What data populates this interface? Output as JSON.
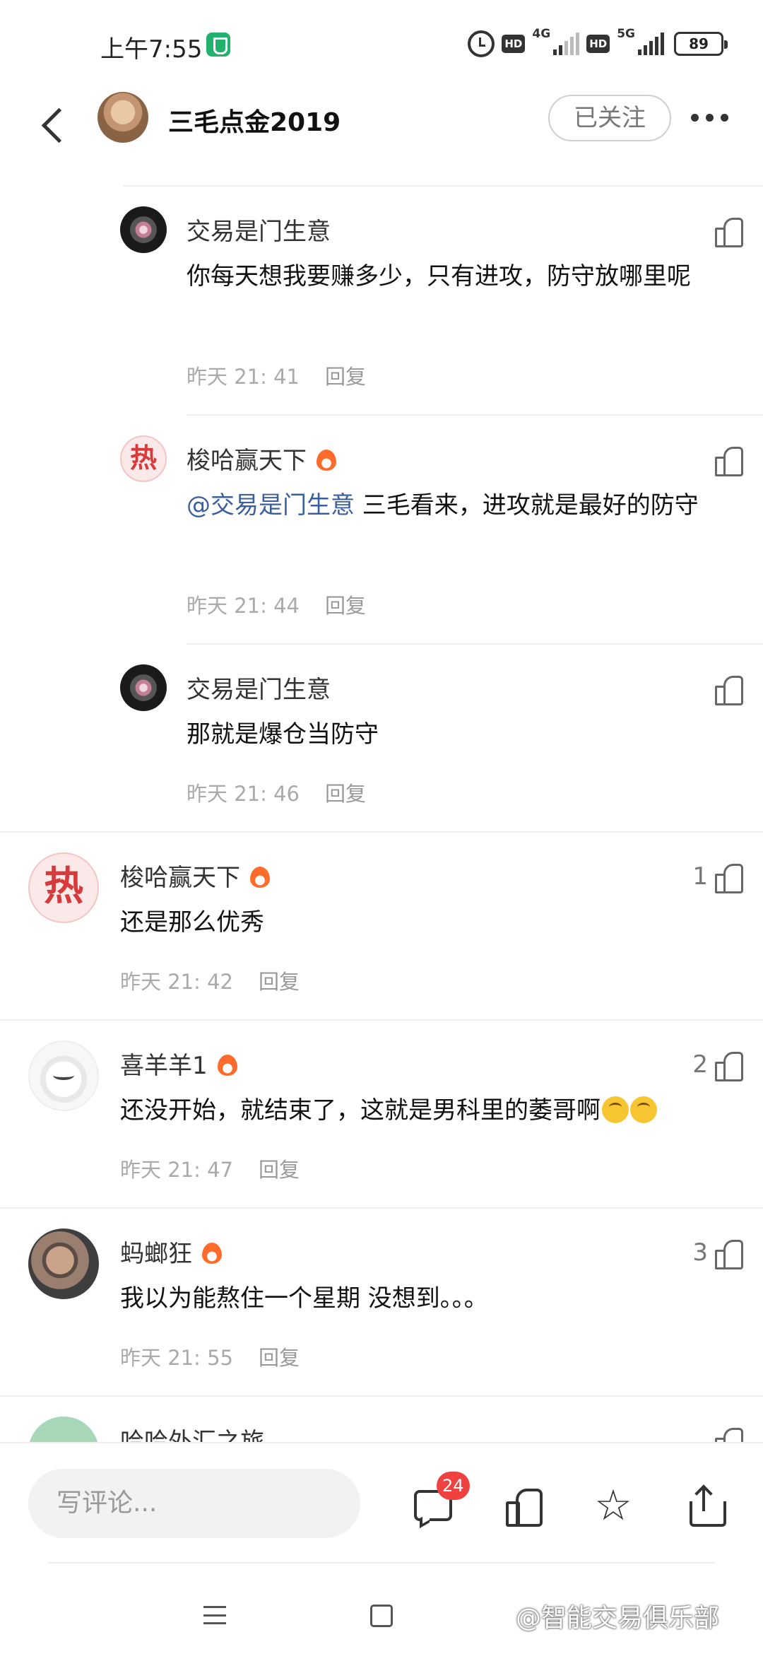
{
  "status_bar": {
    "time": "上午7:55",
    "hd1": "HD",
    "net1": "4G",
    "hd2": "HD",
    "net2": "5G",
    "battery": "89"
  },
  "header": {
    "title": "三毛点金2019",
    "follow_label": "已关注"
  },
  "replies": [
    {
      "name": "交易是门生意",
      "text": "你每天想我要赚多少，只有进攻，防守放哪里呢",
      "time": "昨天 21: 41",
      "reply_label": "回复"
    },
    {
      "name": "梭哈赢天下",
      "avatar_text": "热",
      "mention": "@交易是门生意",
      "text": " 三毛看来，进攻就是最好的防守",
      "time": "昨天 21: 44",
      "reply_label": "回复"
    },
    {
      "name": "交易是门生意",
      "text": "那就是爆仓当防守",
      "time": "昨天 21: 46",
      "reply_label": "回复"
    }
  ],
  "comments": [
    {
      "name": "梭哈赢天下",
      "avatar_text": "热",
      "text": "还是那么优秀",
      "time": "昨天 21: 42",
      "reply_label": "回复",
      "likes": "1"
    },
    {
      "name": "喜羊羊1",
      "text": "还没开始，就结束了，这就是男科里的萎哥啊",
      "time": "昨天 21: 47",
      "reply_label": "回复",
      "likes": "2"
    },
    {
      "name": "蚂螂狂",
      "text": "我以为能熬住一个星期 没想到。。。",
      "time": "昨天 21: 55",
      "reply_label": "回复",
      "likes": "3"
    },
    {
      "name": "哈哈外汇之旅"
    }
  ],
  "bottom_bar": {
    "input_placeholder": "写评论...",
    "comment_count": "24"
  },
  "watermark": "@智能交易俱乐部",
  "colors": {
    "mention": "#3b5f9e",
    "badge": "#f04141",
    "pk_flame": "#ff6b2a",
    "hot_avatar_text": "#d63a3a"
  }
}
